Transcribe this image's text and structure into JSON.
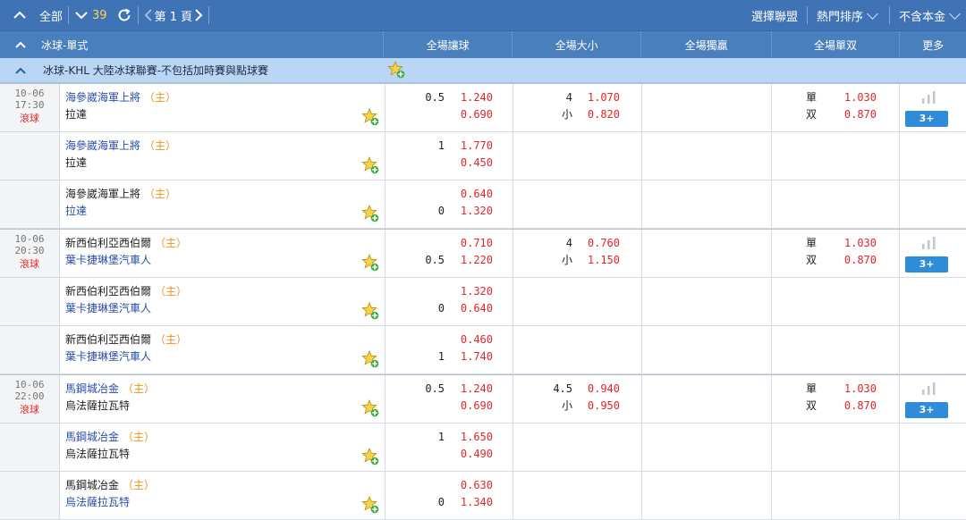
{
  "toolbar": {
    "all_label": "全部",
    "count": "39",
    "page_label": "第 1 頁",
    "select_league": "選擇聯盟",
    "sort_label": "熱門排序",
    "stake_label": "不含本金"
  },
  "columns": {
    "sport": "冰球-單式",
    "handicap": "全場讓球",
    "over_under": "全場大小",
    "moneyline": "全場獨贏",
    "odd_even": "全場單双",
    "more": "更多"
  },
  "league": {
    "name": "冰球-KHL 大陸冰球聯賽-不包括加時賽與點球賽"
  },
  "host_tag": "（主）",
  "live_label": "滾球",
  "more_button": "3+",
  "rows": [
    {
      "date": "10-06",
      "time": "17:30",
      "live": true,
      "home": "海參崴海軍上將",
      "away": "拉達",
      "home_color": "blue",
      "away_color": "black",
      "h_line1": "0.5",
      "h_odds1": "1.240",
      "h_line2": "",
      "h_odds2": "0.690",
      "ou_line1": "4",
      "ou_odds1": "1.070",
      "ou_line2": "小",
      "ou_odds2": "0.820",
      "oe_lbl1": "單",
      "oe_odds1": "1.030",
      "oe_lbl2": "双",
      "oe_odds2": "0.870",
      "more": true
    },
    {
      "home": "海參崴海軍上將",
      "away": "拉達",
      "home_color": "blue",
      "away_color": "black",
      "h_line1": "1",
      "h_odds1": "1.770",
      "h_line2": "",
      "h_odds2": "0.450"
    },
    {
      "home": "海參崴海軍上將",
      "away": "拉達",
      "home_color": "black",
      "away_color": "blue",
      "h_line1": "",
      "h_odds1": "0.640",
      "h_line2": "0",
      "h_odds2": "1.320"
    },
    {
      "date": "10-06",
      "time": "20:30",
      "live": true,
      "home": "新西伯利亞西伯爾",
      "away": "葉卡捷琳堡汽車人",
      "home_color": "black",
      "away_color": "blue",
      "h_line1": "",
      "h_odds1": "0.710",
      "h_line2": "0.5",
      "h_odds2": "1.220",
      "ou_line1": "4",
      "ou_odds1": "0.760",
      "ou_line2": "小",
      "ou_odds2": "1.150",
      "oe_lbl1": "單",
      "oe_odds1": "1.030",
      "oe_lbl2": "双",
      "oe_odds2": "0.870",
      "more": true
    },
    {
      "home": "新西伯利亞西伯爾",
      "away": "葉卡捷琳堡汽車人",
      "home_color": "black",
      "away_color": "blue",
      "h_line1": "",
      "h_odds1": "1.320",
      "h_line2": "0",
      "h_odds2": "0.640"
    },
    {
      "home": "新西伯利亞西伯爾",
      "away": "葉卡捷琳堡汽車人",
      "home_color": "black",
      "away_color": "blue",
      "h_line1": "",
      "h_odds1": "0.460",
      "h_line2": "1",
      "h_odds2": "1.740"
    },
    {
      "date": "10-06",
      "time": "22:00",
      "live": true,
      "home": "馬鋼城冶金",
      "away": "烏法薩拉瓦特",
      "home_color": "blue",
      "away_color": "black",
      "h_line1": "0.5",
      "h_odds1": "1.240",
      "h_line2": "",
      "h_odds2": "0.690",
      "ou_line1": "4.5",
      "ou_odds1": "0.940",
      "ou_line2": "小",
      "ou_odds2": "0.950",
      "oe_lbl1": "單",
      "oe_odds1": "1.030",
      "oe_lbl2": "双",
      "oe_odds2": "0.870",
      "more": true
    },
    {
      "home": "馬鋼城冶金",
      "away": "烏法薩拉瓦特",
      "home_color": "blue",
      "away_color": "black",
      "h_line1": "1",
      "h_odds1": "1.650",
      "h_line2": "",
      "h_odds2": "0.490"
    },
    {
      "home": "馬鋼城冶金",
      "away": "烏法薩拉瓦特",
      "home_color": "black",
      "away_color": "blue",
      "h_line1": "",
      "h_odds1": "0.630",
      "h_line2": "0",
      "h_odds2": "1.340"
    }
  ]
}
